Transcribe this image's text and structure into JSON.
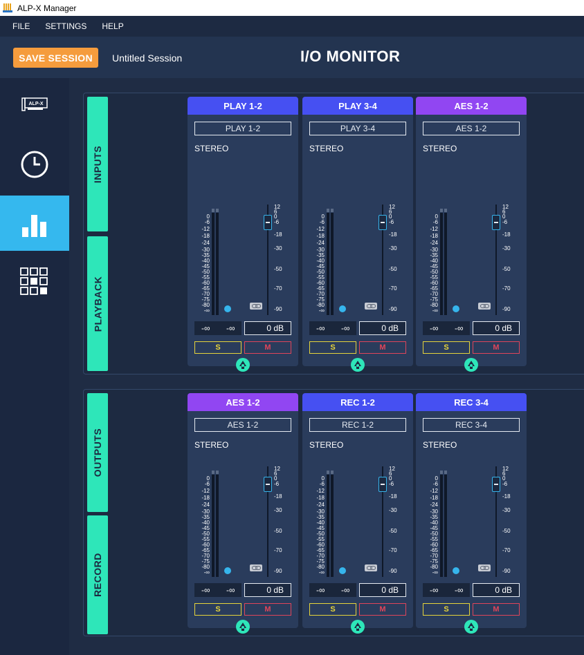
{
  "window": {
    "title": "ALP-X Manager"
  },
  "menu": [
    "FILE",
    "SETTINGS",
    "HELP"
  ],
  "header": {
    "save_label": "SAVE SESSION",
    "session_name": "Untitled Session",
    "page_title": "I/O MONITOR"
  },
  "sidebar": {
    "items": [
      {
        "icon": "alp-x-card-icon",
        "card_label": "ALP-X",
        "active": false
      },
      {
        "icon": "clock-icon",
        "active": false
      },
      {
        "icon": "bar-chart-icon",
        "active": true
      },
      {
        "icon": "grid-icon",
        "active": false
      }
    ]
  },
  "sections": [
    {
      "tab_top": "INPUTS",
      "tab_bottom": "PLAYBACK",
      "channels": [
        {
          "title": "PLAY 1-2",
          "name": "PLAY 1-2",
          "mode": "STEREO",
          "peak_l": "-∞",
          "peak_r": "-∞",
          "gain": "0 dB",
          "solo": "S",
          "mute": "M",
          "header_color": "#4650f2"
        },
        {
          "title": "PLAY 3-4",
          "name": "PLAY 3-4",
          "mode": "STEREO",
          "peak_l": "-∞",
          "peak_r": "-∞",
          "gain": "0 dB",
          "solo": "S",
          "mute": "M",
          "header_color": "#4650f2"
        },
        {
          "title": "AES 1-2",
          "name": "AES 1-2",
          "mode": "STEREO",
          "peak_l": "-∞",
          "peak_r": "-∞",
          "gain": "0 dB",
          "solo": "S",
          "mute": "M",
          "header_color": "#9146f2"
        }
      ]
    },
    {
      "tab_top": "OUTPUTS",
      "tab_bottom": "RECORD",
      "channels": [
        {
          "title": "AES 1-2",
          "name": "AES 1-2",
          "mode": "STEREO",
          "peak_l": "-∞",
          "peak_r": "-∞",
          "gain": "0 dB",
          "solo": "S",
          "mute": "M",
          "header_color": "#9146f2"
        },
        {
          "title": "REC 1-2",
          "name": "REC 1-2",
          "mode": "STEREO",
          "peak_l": "-∞",
          "peak_r": "-∞",
          "gain": "0 dB",
          "solo": "S",
          "mute": "M",
          "header_color": "#4650f2"
        },
        {
          "title": "REC 3-4",
          "name": "REC 3-4",
          "mode": "STEREO",
          "peak_l": "-∞",
          "peak_r": "-∞",
          "gain": "0 dB",
          "solo": "S",
          "mute": "M",
          "header_color": "#4650f2"
        }
      ]
    }
  ],
  "meter_scale": [
    "0",
    "-6",
    "-12",
    "-18",
    "-24",
    "-30",
    "-35",
    "-40",
    "-45",
    "-50",
    "-55",
    "-60",
    "-65",
    "-70",
    "-75",
    "-80",
    "-∞"
  ],
  "fader_scale": [
    "12",
    "6",
    "0",
    "-6",
    "-18",
    "-30",
    "-50",
    "-70",
    "-90"
  ],
  "colors": {
    "accent": "#35b8ee",
    "save": "#f59c3d",
    "tab": "#2ee6b9",
    "solo": "#e7d53b",
    "mute": "#e0455a"
  }
}
